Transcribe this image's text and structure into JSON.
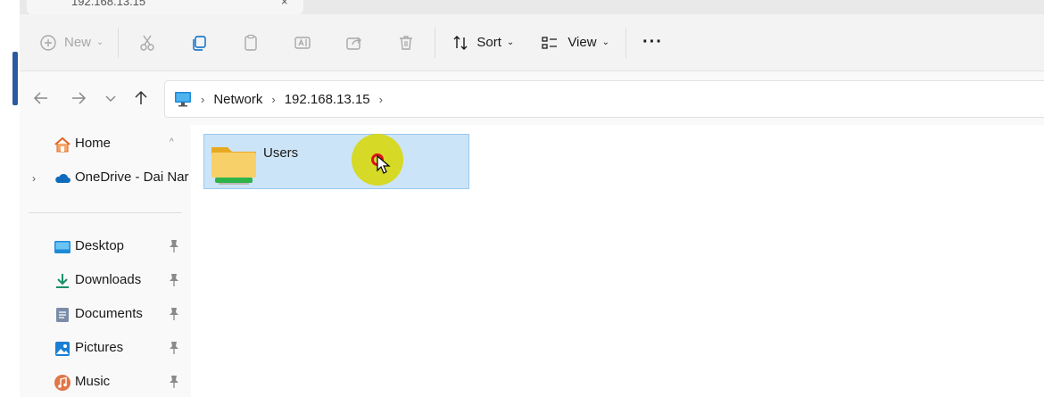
{
  "window": {
    "tab_title": "192.168.13.15",
    "tab_close_label": "×"
  },
  "toolbar": {
    "new_label": "New",
    "sort_label": "Sort",
    "view_label": "View",
    "more_label": "···",
    "chevron": "⌄"
  },
  "address": {
    "crumbs": [
      "Network",
      "192.168.13.15"
    ],
    "separator": "›"
  },
  "sidebar": {
    "items": [
      {
        "label": "Home",
        "icon": "home-icon",
        "pinned": false
      },
      {
        "label": "OneDrive - Dai Nar",
        "icon": "onedrive-icon",
        "pinned": false
      },
      {
        "label": "Desktop",
        "icon": "desktop-icon",
        "pinned": true
      },
      {
        "label": "Downloads",
        "icon": "download-icon",
        "pinned": true
      },
      {
        "label": "Documents",
        "icon": "documents-icon",
        "pinned": true
      },
      {
        "label": "Pictures",
        "icon": "pictures-icon",
        "pinned": true
      },
      {
        "label": "Music",
        "icon": "music-icon",
        "pinned": true
      }
    ],
    "expander_glyph": "›",
    "collapse_glyph": "^"
  },
  "content": {
    "items": [
      {
        "name": "Users",
        "type": "folder",
        "selected": true
      }
    ]
  },
  "colors": {
    "selection_bg": "#cce4f7",
    "selection_border": "#99c9ef",
    "cursor_highlight": "#d7d700",
    "cursor_ring": "#e0101a",
    "accent_blue": "#0067c0"
  }
}
